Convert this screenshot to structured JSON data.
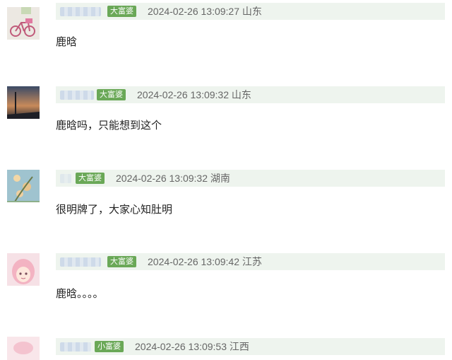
{
  "comments": [
    {
      "badge": "大富婆",
      "timestamp": "2024-02-26 13:09:27",
      "location": "山东",
      "text": "鹿晗"
    },
    {
      "badge": "大富婆",
      "timestamp": "2024-02-26 13:09:32",
      "location": "山东",
      "text": "鹿晗吗，只能想到这个"
    },
    {
      "badge": "大富婆",
      "timestamp": "2024-02-26 13:09:32",
      "location": "湖南",
      "text": "很明牌了，大家心知肚明"
    },
    {
      "badge": "大富婆",
      "timestamp": "2024-02-26 13:09:42",
      "location": "江苏",
      "text": "鹿晗。。。。"
    },
    {
      "badge": "小富婆",
      "timestamp": "2024-02-26 13:09:53",
      "location": "江西",
      "text": ""
    }
  ],
  "colors": {
    "badge_bg": "#6aa857",
    "meta_bar_bg": "#eef4ee"
  }
}
